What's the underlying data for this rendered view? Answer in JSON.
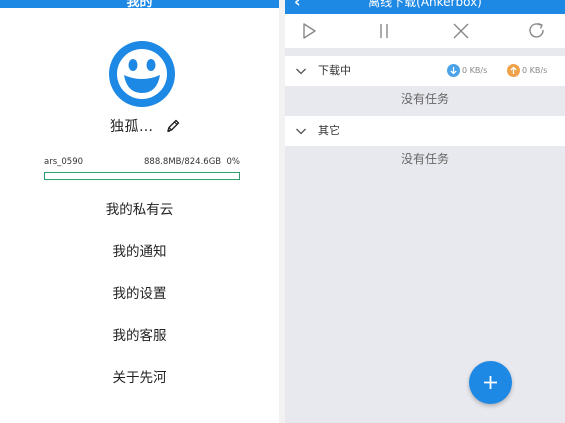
{
  "left": {
    "header_title": "我的",
    "username": "独孤…",
    "storage": {
      "account": "ars_0590",
      "used_total": "888.8MB/824.6GB",
      "percent": "0%",
      "fill_fraction": 0.0
    },
    "menu": [
      {
        "label": "我的私有云"
      },
      {
        "label": "我的通知"
      },
      {
        "label": "我的设置"
      },
      {
        "label": "我的客服"
      },
      {
        "label": "关于先河"
      }
    ]
  },
  "right": {
    "header_title": "离线下载(Ankerbox)",
    "toolbar": {
      "icons": [
        "play-icon",
        "pause-icon",
        "close-icon",
        "refresh-icon"
      ]
    },
    "groups": [
      {
        "label": "下载中",
        "down_speed": "0 KB/s",
        "up_speed": "0 KB/s",
        "empty_text": "没有任务"
      },
      {
        "label": "其它",
        "empty_text": "没有任务"
      }
    ]
  },
  "colors": {
    "brand_blue": "#1e88e5",
    "progress_green": "#2e9e6a",
    "down_speed": "#4aa3e8",
    "up_speed": "#f0a24a",
    "panel_gray": "#e8e9ee"
  }
}
